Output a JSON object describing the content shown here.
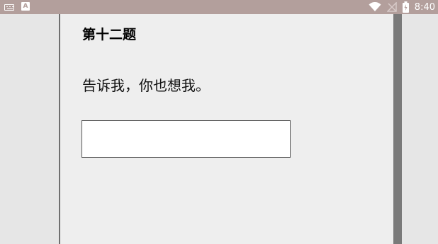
{
  "status_bar": {
    "time": "8:40",
    "left_icons": [
      "keyboard-icon",
      "a-icon"
    ],
    "a_icon_text": "A",
    "right_icons": [
      "wifi-icon",
      "no-signal-icon",
      "battery-icon"
    ]
  },
  "quiz": {
    "title": "第十二题",
    "question": "告诉我，你也想我。",
    "answer_value": "",
    "answer_placeholder": ""
  },
  "colors": {
    "status_bar_bg": "#b39f9c",
    "page_bg": "#eeeeee",
    "outer_bg": "#e6e6e6"
  }
}
